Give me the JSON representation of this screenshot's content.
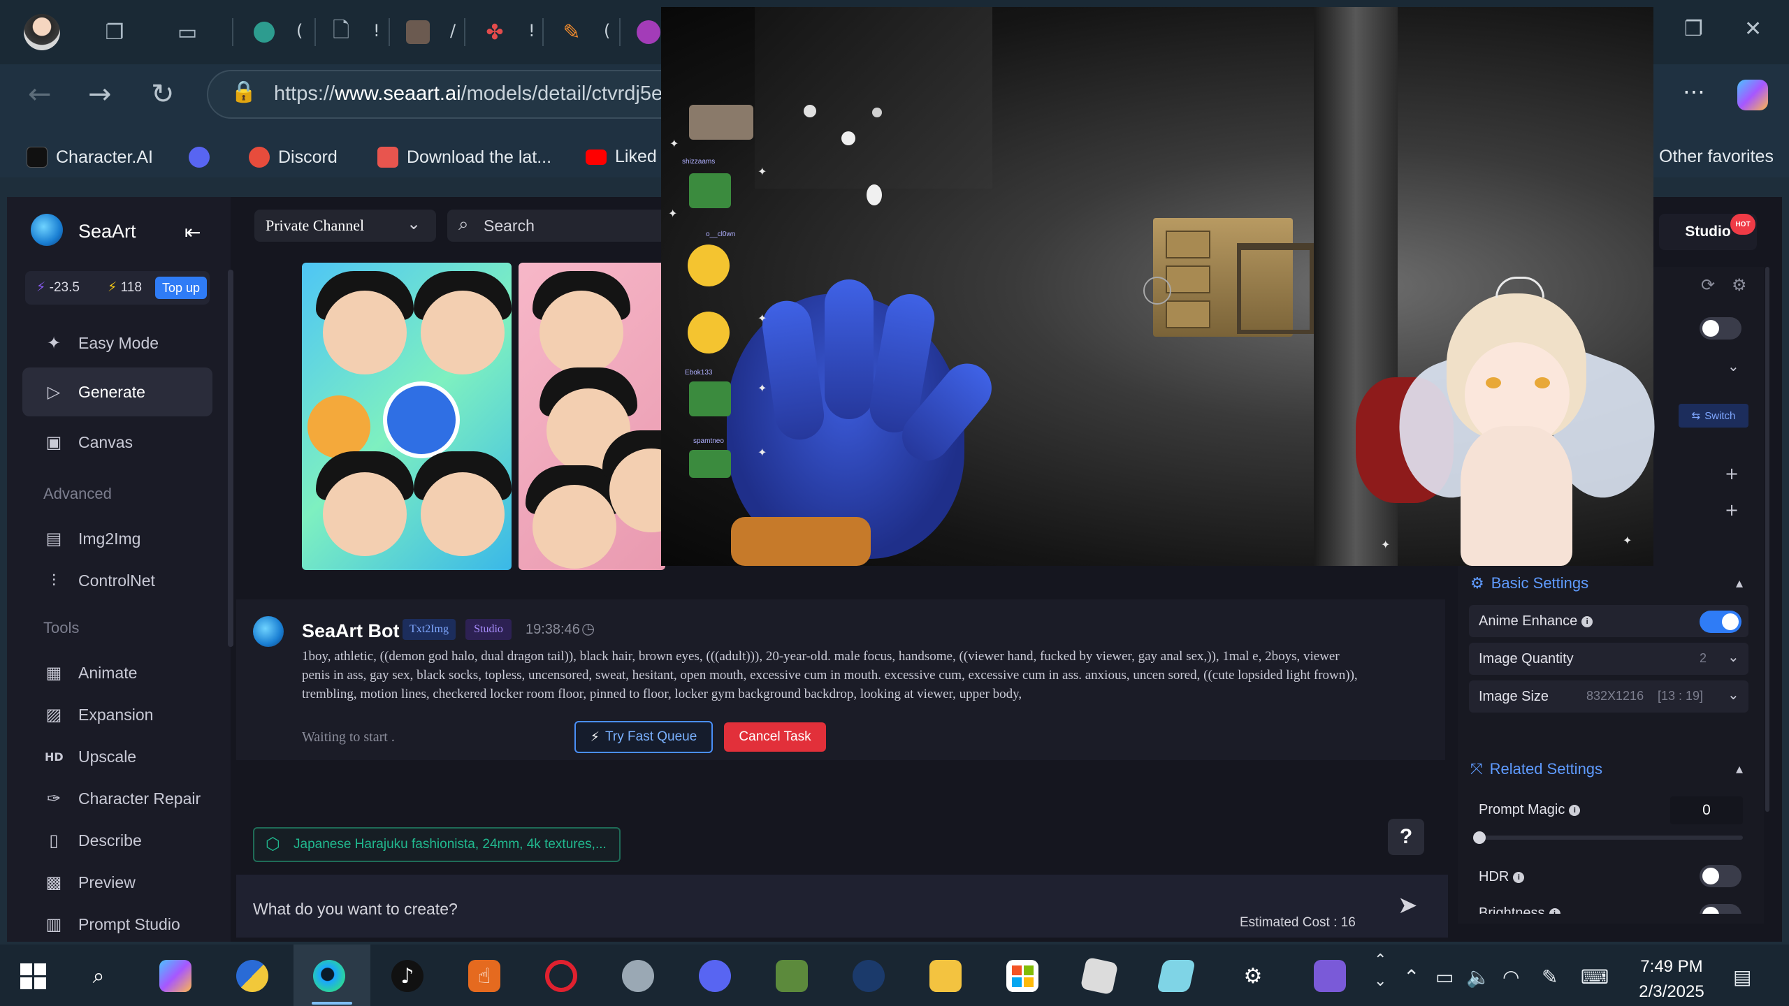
{
  "browser": {
    "tabs": [
      "(",
      "!",
      "/",
      "!",
      "("
    ],
    "url_prefix": "https://",
    "url_domain": "www.seaart.ai",
    "url_path": "/models/detail/ctvrdj5e",
    "favorites": [
      {
        "label": "Character.AI",
        "icon": "character-ai-icon",
        "color": "#111111"
      },
      {
        "label": "",
        "icon": "discord-icon",
        "color": "#5865f2"
      },
      {
        "label": "Discord",
        "icon": "discord-8k-icon",
        "color": "#e74c3c"
      },
      {
        "label": "Download the lat...",
        "icon": "download-store-icon",
        "color": "#e8554e"
      },
      {
        "label": "Liked",
        "icon": "youtube-icon",
        "color": "#ff0000"
      }
    ],
    "other_favorites": "Other favorites"
  },
  "sidebar": {
    "brand": "SeaArt",
    "credits_a": "-23.5",
    "credits_b": "118",
    "topup": "Top up",
    "items": [
      {
        "label": "Easy Mode",
        "icon": "sparkle-icon"
      },
      {
        "label": "Generate",
        "icon": "play-icon"
      },
      {
        "label": "Canvas",
        "icon": "canvas-icon"
      }
    ],
    "advanced_head": "Advanced",
    "advanced": [
      {
        "label": "Img2Img",
        "icon": "image-icon"
      },
      {
        "label": "ControlNet",
        "icon": "sliders-icon"
      }
    ],
    "tools_head": "Tools",
    "tools": [
      {
        "label": "Animate",
        "icon": "animate-icon"
      },
      {
        "label": "Expansion",
        "icon": "expansion-icon"
      },
      {
        "label": "Upscale",
        "icon": "hd-icon"
      },
      {
        "label": "Character Repair",
        "icon": "repair-icon"
      },
      {
        "label": "Describe",
        "icon": "describe-icon"
      },
      {
        "label": "Preview",
        "icon": "preview-icon"
      },
      {
        "label": "Prompt Studio",
        "icon": "prompt-studio-icon"
      }
    ]
  },
  "center": {
    "channel": "Private Channel",
    "search": "Search",
    "bot_name": "SeaArt Bot",
    "tag1": "Txt2Img",
    "tag2": "Studio",
    "time": "19:38:46",
    "prompt": "1boy, athletic, ((demon god halo, dual dragon tail)), black hair, brown eyes, (((adult))), 20-year-old. male focus, handsome, ((viewer hand, fucked by viewer, gay anal sex,)), 1mal e, 2boys, viewer penis in ass, gay sex, black socks, topless, uncensored, sweat, hesitant, open mouth, excessive cum in mouth. excessive cum, excessive cum in ass. anxious, uncen sored, ((cute lopsided light frown)), trembling, motion lines, checkered locker room floor, pinned to floor, locker gym background backdrop, looking at viewer, upper body,",
    "waiting": "Waiting to start .",
    "fast_queue": "Try Fast Queue",
    "cancel": "Cancel Task",
    "suggestion": "Japanese Harajuku fashionista, 24mm, 4k textures,...",
    "help": "?",
    "input_placeholder": "What do you want to create?",
    "cost": "Estimated Cost : 16"
  },
  "right": {
    "studio": "Studio",
    "hot": "HOT",
    "switch": "Switch",
    "basic_title": "Basic Settings",
    "anime_enhance": "Anime Enhance",
    "anime_enhance_on": true,
    "image_quantity": "Image Quantity",
    "image_quantity_val": "2",
    "image_size": "Image Size",
    "image_size_val": "832X1216",
    "image_ratio": "[13 : 19]",
    "related_title": "Related Settings",
    "prompt_magic": "Prompt Magic",
    "prompt_magic_val": "0",
    "prompt_magic_level": 0,
    "hdr": "HDR",
    "brightness": "Brightness"
  },
  "overlay": {
    "chat_names": [
      "shizzaams",
      "o__cl0wn",
      "Ebok133",
      "spamtneo"
    ]
  },
  "taskbar": {
    "time": "7:49 PM",
    "date": "2/3/2025"
  }
}
